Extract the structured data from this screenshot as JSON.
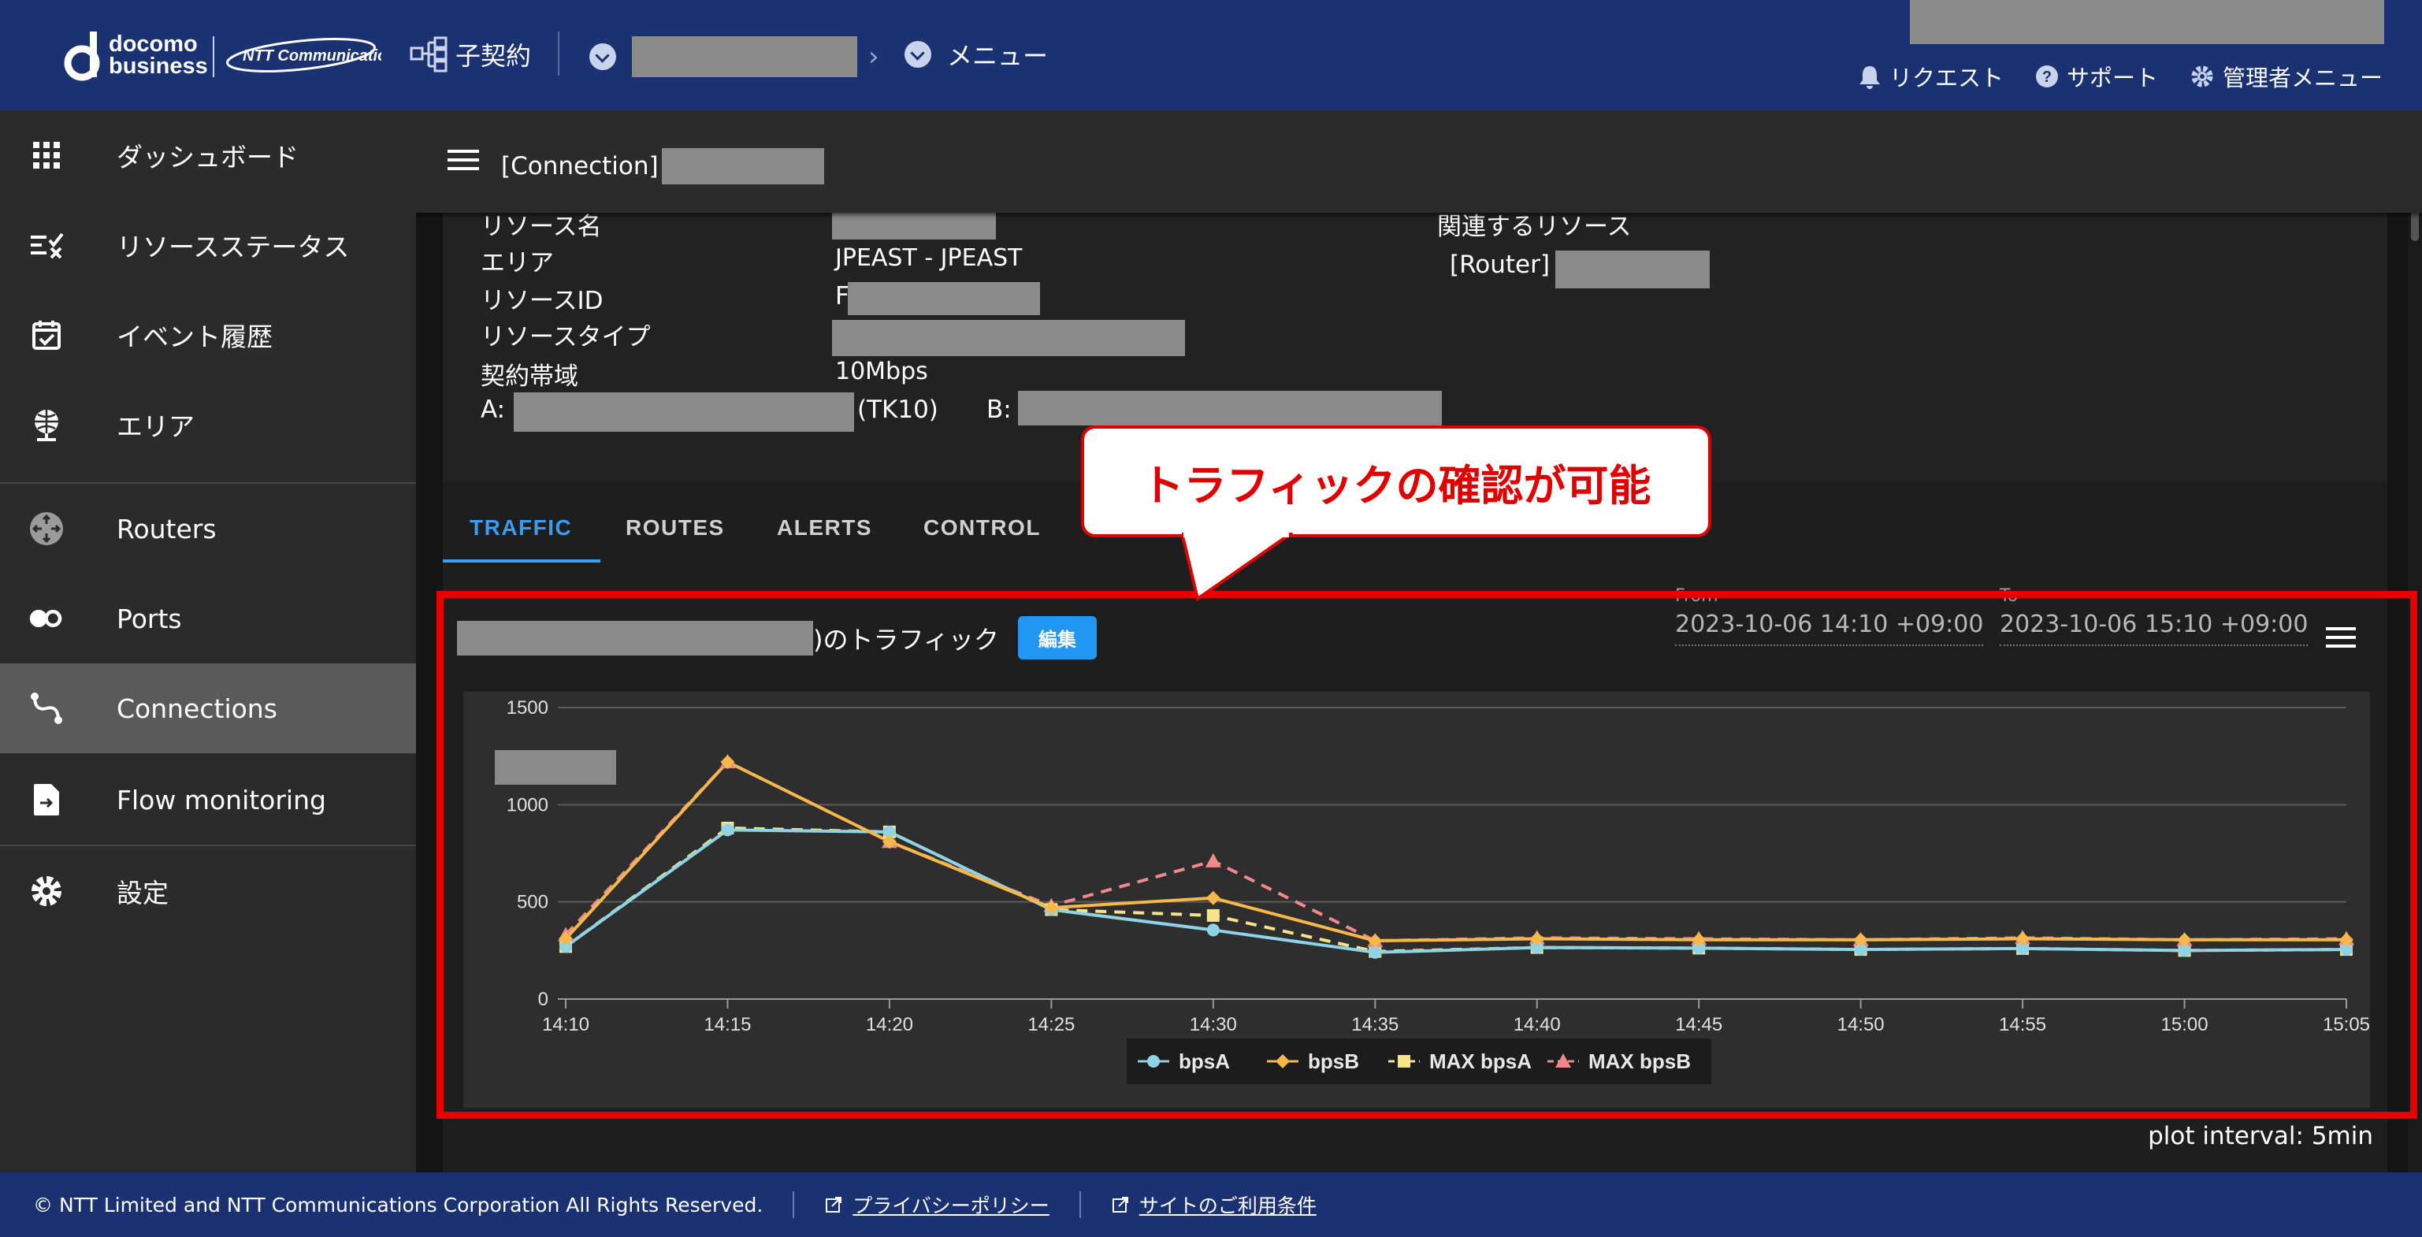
{
  "brand": {
    "line1": "docomo",
    "line2": "business",
    "partner": "NTT Communications"
  },
  "header": {
    "contract_label": "子契約",
    "menu_label": "メニュー",
    "request_label": "リクエスト",
    "support_label": "サポート",
    "admin_label": "管理者メニュー"
  },
  "sidebar": {
    "items": [
      {
        "label": "ダッシュボード",
        "icon": "grid-icon"
      },
      {
        "label": "リソースステータス",
        "icon": "checklist-icon"
      },
      {
        "label": "イベント履歴",
        "icon": "calendar-check-icon"
      },
      {
        "label": "エリア",
        "icon": "globe-pin-icon"
      },
      {
        "label": "Routers",
        "icon": "router-icon"
      },
      {
        "label": "Ports",
        "icon": "port-icon"
      },
      {
        "label": "Connections",
        "icon": "connection-icon"
      },
      {
        "label": "Flow monitoring",
        "icon": "file-arrow-icon"
      },
      {
        "label": "設定",
        "icon": "gear-icon"
      }
    ]
  },
  "subheader": {
    "title": "[Connection]"
  },
  "resource": {
    "name_label": "リソース名",
    "area_label": "エリア",
    "area_value": "JPEAST - JPEAST",
    "id_label": "リソースID",
    "id_prefix": "F",
    "type_label": "リソースタイプ",
    "bandwidth_label": "契約帯域",
    "bandwidth_value": "10Mbps",
    "a_label": "A:",
    "a_suffix": "(TK10)",
    "b_label": "B:",
    "related_label": "関連するリソース",
    "related_router": "[Router]"
  },
  "tabs": [
    "TRAFFIC",
    "ROUTES",
    "ALERTS",
    "CONTROL"
  ],
  "callout": "トラフィックの確認が可能",
  "traffic": {
    "title_suffix": ")のトラフィック",
    "edit_label": "編集",
    "from_label": "From",
    "from_value": "2023-10-06 14:10 +09:00",
    "to_label": "To",
    "to_value": "2023-10-06 15:10 +09:00",
    "plot_interval": "plot interval: 5min"
  },
  "chart_data": {
    "type": "line",
    "x": [
      "14:10",
      "14:15",
      "14:20",
      "14:25",
      "14:30",
      "14:35",
      "14:40",
      "14:45",
      "14:50",
      "14:55",
      "15:00",
      "15:05"
    ],
    "ylim": [
      0,
      1500
    ],
    "yticks": [
      0,
      500,
      1000,
      1500
    ],
    "grid": true,
    "legend": "bottom",
    "series": [
      {
        "name": "bpsA",
        "color": "#8fd3e6",
        "dash": false,
        "marker": "circle",
        "values": [
          270,
          870,
          860,
          460,
          355,
          240,
          265,
          262,
          255,
          260,
          250,
          255
        ]
      },
      {
        "name": "bpsB",
        "color": "#f7b84a",
        "dash": false,
        "marker": "diamond",
        "values": [
          310,
          1220,
          810,
          470,
          520,
          300,
          310,
          305,
          305,
          310,
          305,
          305
        ]
      },
      {
        "name": "MAX bpsA",
        "color": "#f4e38a",
        "dash": true,
        "marker": "square",
        "values": [
          270,
          880,
          860,
          460,
          430,
          245,
          265,
          262,
          255,
          260,
          250,
          255
        ]
      },
      {
        "name": "MAX bpsB",
        "color": "#f08a8a",
        "dash": true,
        "marker": "triangle",
        "values": [
          330,
          1220,
          810,
          480,
          710,
          300,
          315,
          310,
          305,
          315,
          305,
          310
        ]
      }
    ]
  },
  "footer": {
    "copyright": "© NTT Limited and NTT Communications Corporation All Rights Reserved.",
    "privacy": "プライバシーポリシー",
    "terms": "サイトのご利用条件"
  }
}
